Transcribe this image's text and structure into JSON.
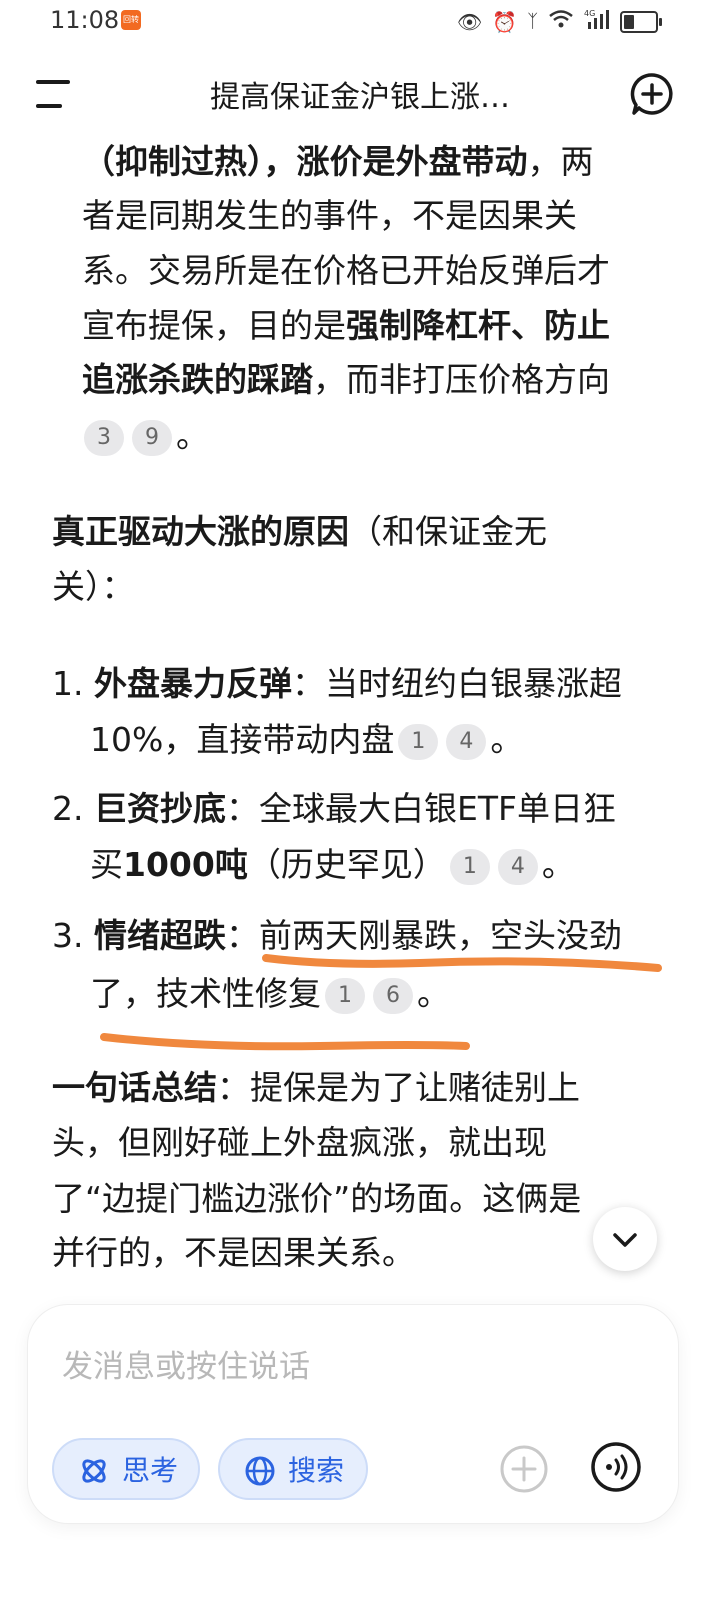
{
  "status_bar": {
    "time": "11:08",
    "app_badge": "回转",
    "network": "4G",
    "battery_level": 0.35
  },
  "header": {
    "title": "提高保证金沪银上涨…",
    "menu_icon": "menu-icon",
    "new_chat_icon": "new-chat-icon"
  },
  "message": {
    "p1": {
      "l1_a": "（抑制过热），涨价是外盘带动",
      "l1_b": "，两",
      "l2": "者是同期发生的事件，不是因果关",
      "l3": "系。交易所是在价格已开始反弹后才",
      "l4_a": "宣布提保，目的是",
      "l4_b": "强制降杠杆、防止",
      "l5_a": "追涨杀跌的踩踏",
      "l5_b": "，而非打压价格方向",
      "cites": [
        "3",
        "9"
      ],
      "end": "。"
    },
    "heading": {
      "bold": "真正驱动大涨的原因",
      "normal": "（和保证金无",
      "line2": "关）："
    },
    "items": [
      {
        "num": "1.",
        "title": "外盘暴力反弹",
        "text1": "：当时纽约白银暴涨超",
        "text2": "10%，直接带动内盘",
        "cites": [
          "1",
          "4"
        ],
        "end": "。"
      },
      {
        "num": "2.",
        "title": "巨资抄底",
        "text1": "：全球最大白银ETF单日狂",
        "text2_a": "买",
        "text2_b": "1000吨",
        "text2_c": "（历史罕见）",
        "cites": [
          "1",
          "4"
        ],
        "end": "。"
      },
      {
        "num": "3.",
        "title": "情绪超跌",
        "text1": "：前两天刚暴跌，空头没劲",
        "text2": "了，技术性修复",
        "cites": [
          "1",
          "6"
        ],
        "end": "。"
      }
    ],
    "summary": {
      "bold": "一句话总结",
      "l1": "：提保是为了让赌徒别上",
      "l2": "头，但刚好碰上外盘疯涨，就出现",
      "l3": "了“边提门槛边涨价”的场面。这俩是",
      "l4": "并行的，不是因果关系。"
    }
  },
  "annotation_color": "#f0883e",
  "composer": {
    "placeholder": "发消息或按住说话",
    "think_label": "思考",
    "search_label": "搜索"
  }
}
